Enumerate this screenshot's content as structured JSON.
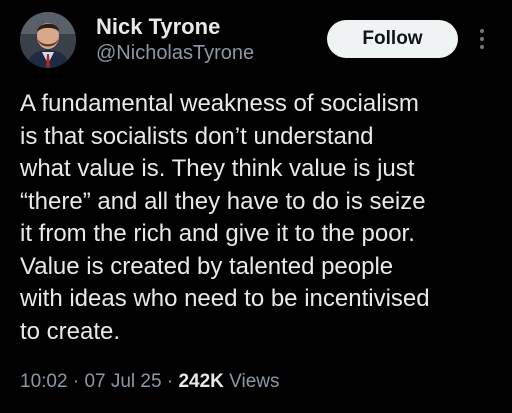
{
  "author": {
    "name": "Nick Tyrone",
    "handle": "@NicholasTyrone",
    "avatar_icon": "profile-photo"
  },
  "actions": {
    "follow_label": "Follow",
    "more_icon": "more-vertical-icon"
  },
  "tweet": {
    "lines": [
      "A fundamental weakness of socialism",
      "is that socialists don’t understand",
      "what value is. They think value is just",
      "“there” and all they have to do is seize",
      "it from the rich and give it to the poor.",
      "Value is created by talented people",
      "with ideas who need to be incentivised",
      "to create."
    ]
  },
  "meta": {
    "time": "10:02",
    "separator": "·",
    "date": "07 Jul 25",
    "views_count": "242K",
    "views_label": "Views"
  },
  "colors": {
    "background": "#000000",
    "text_primary": "#e7e9ea",
    "text_secondary": "#8b98a5",
    "follow_button_bg": "#eff3f4"
  }
}
